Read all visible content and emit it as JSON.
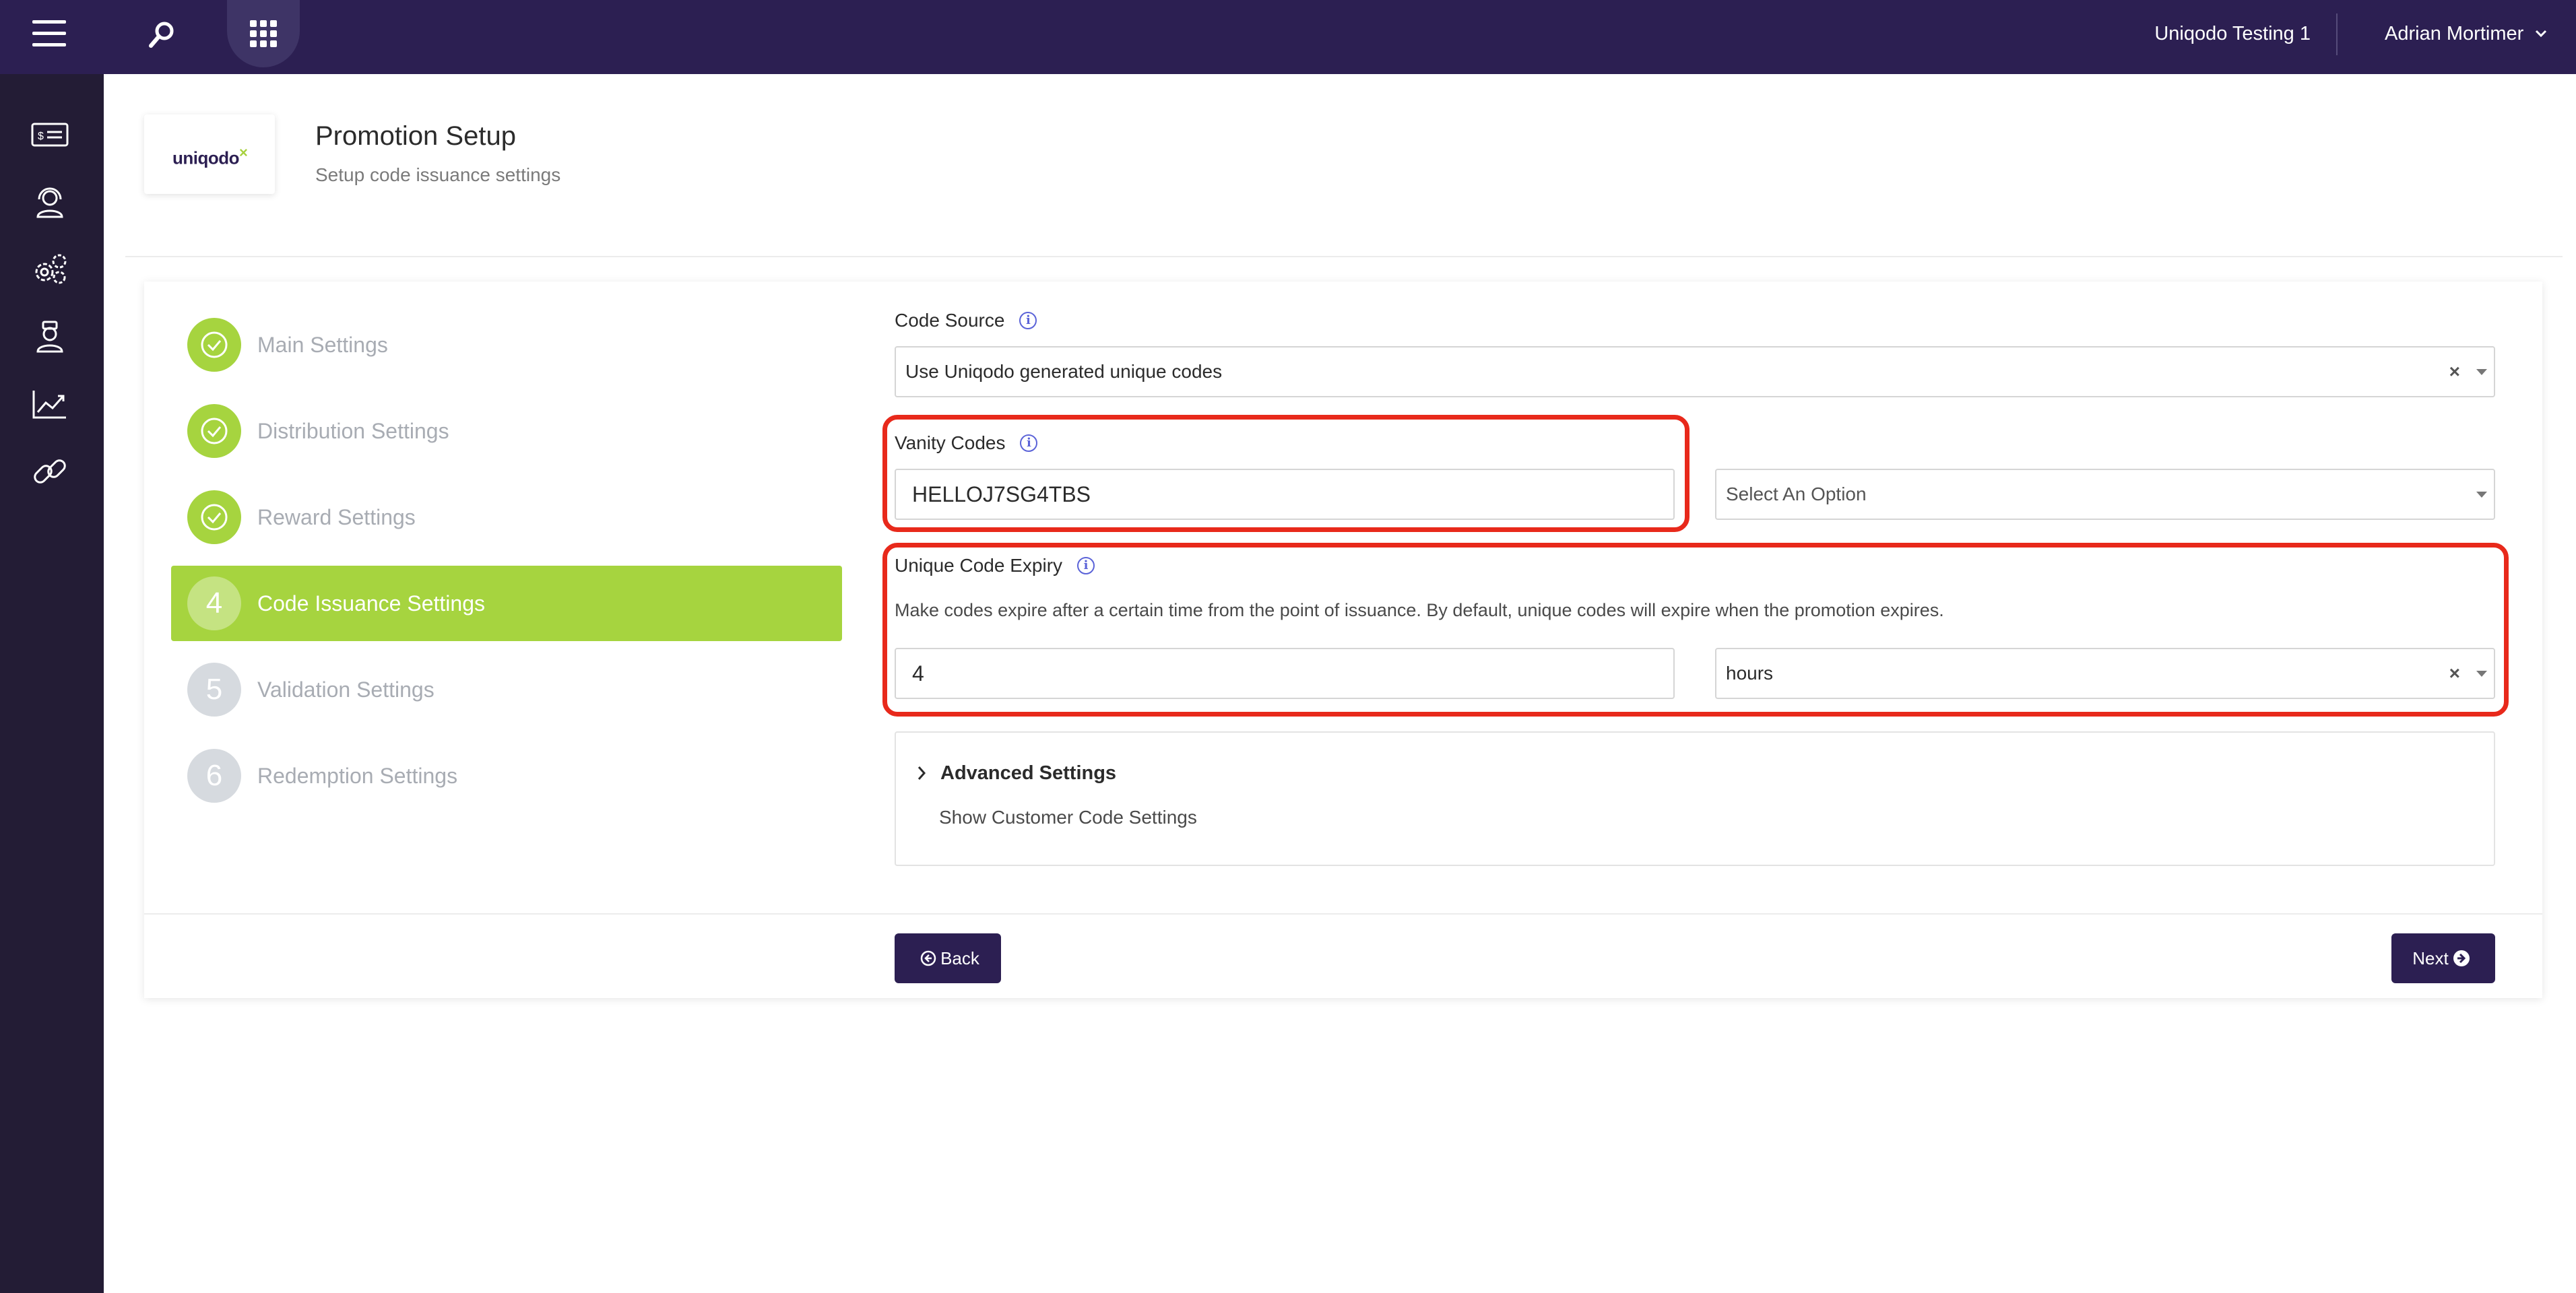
{
  "topbar": {
    "org_name": "Uniqodo Testing 1",
    "user_name": "Adrian Mortimer"
  },
  "sidebar": {
    "items": [
      {
        "icon": "voucher-icon"
      },
      {
        "icon": "support-agent-icon"
      },
      {
        "icon": "settings-gears-icon"
      },
      {
        "icon": "user-badge-icon"
      },
      {
        "icon": "analytics-chart-icon"
      },
      {
        "icon": "link-icon"
      }
    ]
  },
  "header": {
    "logo_text": "uniqodo",
    "title": "Promotion Setup",
    "subtitle": "Setup code issuance settings"
  },
  "steps": [
    {
      "label": "Main Settings",
      "status": "done"
    },
    {
      "label": "Distribution Settings",
      "status": "done"
    },
    {
      "label": "Reward Settings",
      "status": "done"
    },
    {
      "number": "4",
      "label": "Code Issuance Settings",
      "status": "active"
    },
    {
      "number": "5",
      "label": "Validation Settings",
      "status": "pending"
    },
    {
      "number": "6",
      "label": "Redemption Settings",
      "status": "pending"
    }
  ],
  "form": {
    "code_source": {
      "label": "Code Source",
      "value": "Use Uniqodo generated unique codes"
    },
    "vanity_codes": {
      "label": "Vanity Codes",
      "value": "HELLOJ7SG4TBS",
      "select_placeholder": "Select An Option"
    },
    "unique_code_expiry": {
      "label": "Unique Code Expiry",
      "description": "Make codes expire after a certain time from the point of issuance. By default, unique codes will expire when the promotion expires.",
      "value": "4",
      "unit": "hours"
    },
    "advanced": {
      "title": "Advanced Settings",
      "link": "Show Customer Code Settings"
    }
  },
  "buttons": {
    "back": "Back",
    "next": "Next"
  },
  "colors": {
    "topbar": "#2c1f52",
    "sidebar": "#231c35",
    "accent_green": "#a6d43f",
    "highlight_red": "#e8291b",
    "button": "#2c1f52"
  }
}
